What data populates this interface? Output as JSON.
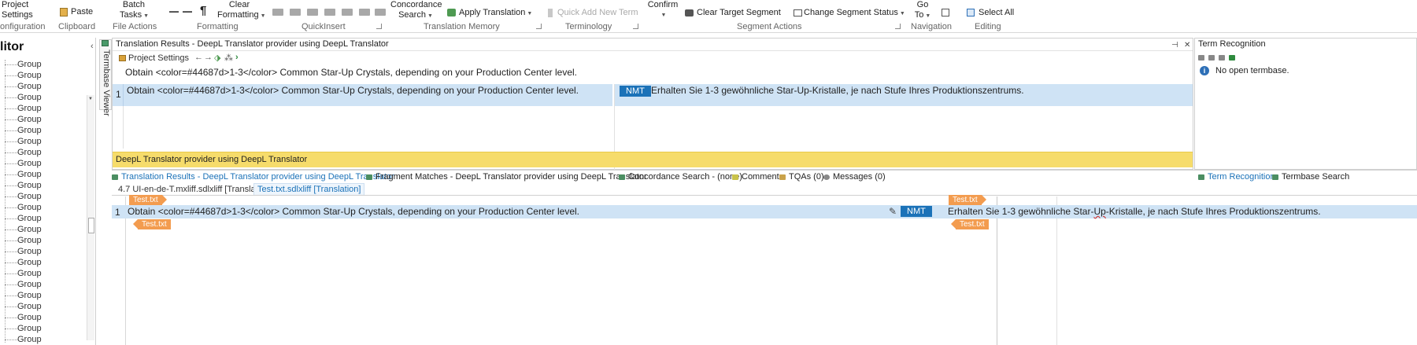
{
  "ribbon": {
    "groups": [
      {
        "label": "onfiguration",
        "items": [
          "Project",
          "Settings"
        ]
      },
      {
        "label": "Clipboard",
        "items": [
          "Paste"
        ]
      },
      {
        "label": "File Actions",
        "items": [
          "Batch",
          "Tasks"
        ]
      },
      {
        "label": "Formatting",
        "items": [
          "Clear",
          "Formatting"
        ]
      },
      {
        "label": "QuickInsert",
        "items": []
      },
      {
        "label": "Translation Memory",
        "items": [
          "Concordance",
          "Search",
          "Apply Translation"
        ]
      },
      {
        "label": "Terminology",
        "items": [
          "Quick Add New Term"
        ]
      },
      {
        "label": "Segment Actions",
        "items": [
          "Confirm",
          "Clear Target Segment",
          "Change Segment Status"
        ]
      },
      {
        "label": "Navigation",
        "items": [
          "Go",
          "To"
        ]
      },
      {
        "label": "Editing",
        "items": [
          "Select All"
        ]
      }
    ]
  },
  "left_panel": {
    "title": "litor",
    "collapse_icon": "chevron-left-icon",
    "items": [
      "Group",
      "Group",
      "Group",
      "Group",
      "Group",
      "Group",
      "Group",
      "Group",
      "Group",
      "Group",
      "Group",
      "Group",
      "Group",
      "Group",
      "Group",
      "Group",
      "Group",
      "Group",
      "Group",
      "Group",
      "Group",
      "Group",
      "Group",
      "Group",
      "Group",
      "Group"
    ]
  },
  "termbase_strip": {
    "label": "Termbase Viewer"
  },
  "translation_results": {
    "title": "Translation Results - DeepL Translator provider using DeepL Translator",
    "toolbar_label": "Project Settings",
    "source_text": "Obtain <color=#44687d>1-3</color> Common Star-Up Crystals, depending on your Production Center level.",
    "row": {
      "number": "1",
      "source": "Obtain <color=#44687d>1-3</color> Common Star-Up Crystals, depending on your Production Center level.",
      "badge": "NMT",
      "target": "Erhalten Sie 1-3 gewöhnliche Star-Up-Kristalle, je nach Stufe Ihres Produktionszentrums."
    },
    "provider_bar": "DeepL Translator provider using DeepL Translator"
  },
  "term_recognition": {
    "title": "Term Recognition",
    "message": "No open termbase."
  },
  "tabs": [
    {
      "label": "Translation Results - DeepL Translator provider using DeepL Translator",
      "active": true
    },
    {
      "label": "Fragment Matches - DeepL Translator provider using DeepL Translator",
      "active": false
    },
    {
      "label": "Concordance Search - (none)",
      "active": false
    },
    {
      "label": "Comments",
      "active": false
    },
    {
      "label": "TQAs (0)",
      "active": false
    },
    {
      "label": "Messages (0)",
      "active": false
    },
    {
      "label": "Term Recognition",
      "active": true
    },
    {
      "label": "Termbase Search",
      "active": false
    }
  ],
  "doc_tabs": [
    {
      "label": "4.7 UI-en-de-T.mxliff.sdlxliff [Translation]",
      "active": false
    },
    {
      "label": "Test.txt.sdlxliff [Translation]",
      "active": true
    }
  ],
  "editor": {
    "tag_label": "Test.txt",
    "row": {
      "number": "1",
      "source": "Obtain <color=#44687d>1-3</color> Common Star-Up Crystals, depending on your Production Center level.",
      "badge": "NMT",
      "target_pre": "Erhalten Sie 1-3 gewöhnliche Star-",
      "target_squiggle": "Up",
      "target_post": "-Kristalle, je nach Stufe Ihres Produktionszentrums."
    }
  },
  "colors": {
    "accent": "#1b72b8",
    "row_highlight": "#cfe3f5",
    "provider_bar": "#f6dc6b",
    "tag": "#f39c4f"
  }
}
